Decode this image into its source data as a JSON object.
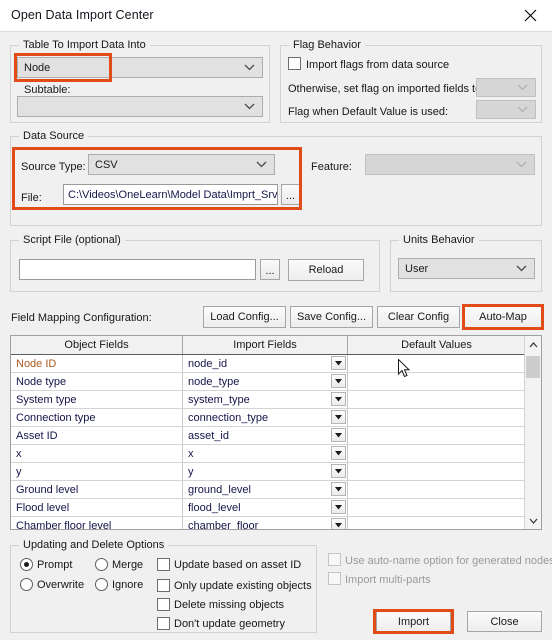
{
  "window": {
    "title": "Open Data Import Center",
    "close_icon": "close-icon"
  },
  "table_group": {
    "title": "Table To Import Data Into",
    "table_value": "Node",
    "subtable_label": "Subtable:",
    "subtable_value": ""
  },
  "flag_group": {
    "title": "Flag Behavior",
    "import_flags_label": "Import flags from data source",
    "import_flags_checked": false,
    "otherwise_label": "Otherwise, set flag on imported fields to:",
    "otherwise_value": "",
    "default_flag_label": "Flag when Default Value is used:",
    "default_flag_value": ""
  },
  "data_source": {
    "title": "Data Source",
    "source_type_label": "Source Type:",
    "source_type_value": "CSV",
    "file_label": "File:",
    "file_value": "C:\\Videos\\OneLearn\\Model Data\\Imprt_Srvy",
    "browse_label": "...",
    "feature_label": "Feature:",
    "feature_value": ""
  },
  "script_group": {
    "title": "Script File (optional)",
    "script_value": "",
    "browse_label": "...",
    "reload_label": "Reload"
  },
  "units_group": {
    "title": "Units Behavior",
    "units_value": "User"
  },
  "field_mapping": {
    "label": "Field Mapping Configuration:",
    "load_config_label": "Load Config...",
    "save_config_label": "Save Config...",
    "clear_config_label": "Clear Config",
    "auto_map_label": "Auto-Map"
  },
  "grid": {
    "columns": [
      "Object Fields",
      "Import Fields",
      "Default Values"
    ],
    "rows": [
      {
        "object_field": "Node ID",
        "import_field": "node_id",
        "default_value": "",
        "key": true
      },
      {
        "object_field": "Node type",
        "import_field": "node_type",
        "default_value": "",
        "key": false
      },
      {
        "object_field": "System type",
        "import_field": "system_type",
        "default_value": "",
        "key": false
      },
      {
        "object_field": "Connection type",
        "import_field": "connection_type",
        "default_value": "",
        "key": false
      },
      {
        "object_field": "Asset ID",
        "import_field": "asset_id",
        "default_value": "",
        "key": false
      },
      {
        "object_field": "x",
        "import_field": "x",
        "default_value": "",
        "key": false
      },
      {
        "object_field": "y",
        "import_field": "y",
        "default_value": "",
        "key": false
      },
      {
        "object_field": "Ground level",
        "import_field": "ground_level",
        "default_value": "",
        "key": false
      },
      {
        "object_field": "Flood level",
        "import_field": "flood_level",
        "default_value": "",
        "key": false
      },
      {
        "object_field": "Chamber floor level",
        "import_field": "chamber_floor",
        "default_value": "",
        "key": false
      }
    ],
    "scroll_up_icon": "chevron-up-icon",
    "scroll_down_icon": "chevron-down-icon"
  },
  "update_group": {
    "title": "Updating and Delete Options",
    "radios": [
      {
        "label": "Prompt",
        "selected": true
      },
      {
        "label": "Merge",
        "selected": false
      },
      {
        "label": "Overwrite",
        "selected": false
      },
      {
        "label": "Ignore",
        "selected": false
      }
    ],
    "checkboxes": [
      {
        "label": "Update based on asset ID",
        "checked": false
      },
      {
        "label": "Only update existing objects",
        "checked": false
      },
      {
        "label": "Delete missing objects",
        "checked": false
      },
      {
        "label": "Don't update geometry",
        "checked": false
      }
    ]
  },
  "right_options": {
    "auto_name_label": "Use auto-name option for generated nodes",
    "auto_name_checked": false,
    "auto_name_disabled": true,
    "multi_parts_label": "Import multi-parts",
    "multi_parts_checked": false,
    "multi_parts_disabled": true
  },
  "footer": {
    "import_label": "Import",
    "close_label": "Close"
  },
  "colors": {
    "highlight": "#e04b18",
    "focus": "#3b8fd4",
    "key_field": "#a85a20",
    "field_text": "#15154a"
  }
}
